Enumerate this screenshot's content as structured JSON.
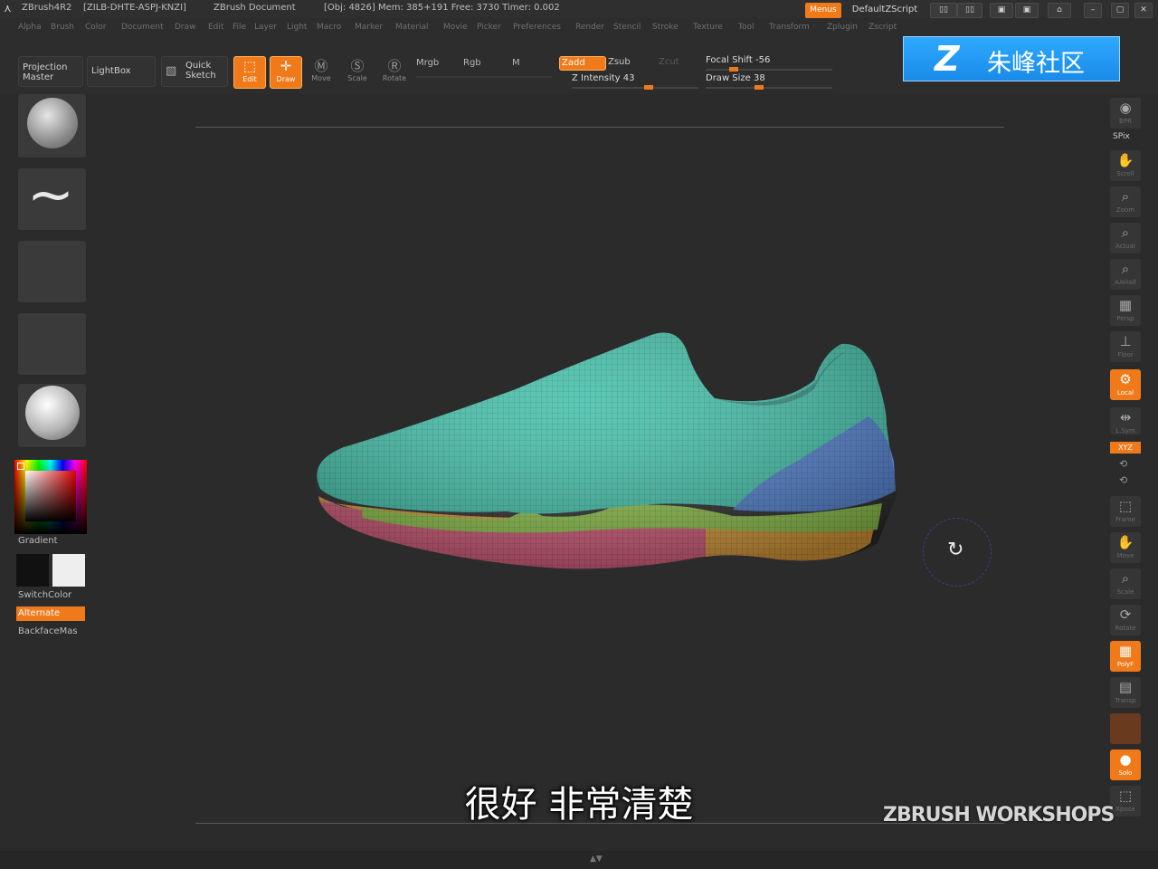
{
  "titlebar": {
    "app": "ZBrush4R2",
    "serial": "[ZILB-DHTE-ASPJ-KNZI]",
    "doc": "ZBrush Document",
    "stats": "[Obj: 4826] Mem: 385+191  Free: 3730  Timer: 0.002",
    "menus_label": "Menus",
    "script_label": "DefaultZScript"
  },
  "menubar": [
    "Alpha",
    "Brush",
    "Color",
    "Document",
    "Draw",
    "Edit",
    "File",
    "Layer",
    "Light",
    "Macro",
    "Marker",
    "Material",
    "Movie",
    "Picker",
    "Preferences",
    "Render",
    "Stencil",
    "Stroke",
    "Texture",
    "Tool",
    "Transform",
    "Zplugin",
    "Zscript"
  ],
  "toolbar": {
    "projection_master": "Projection Master",
    "lightbox": "LightBox",
    "quick_sketch": "Quick Sketch",
    "edit": "Edit",
    "draw": "Draw",
    "move": "Move",
    "scale": "Scale",
    "rotate": "Rotate",
    "mrgb": "Mrgb",
    "rgb": "Rgb",
    "m": "M",
    "zadd": "Zadd",
    "zsub": "Zsub",
    "zcut": "Zcut",
    "z_intensity": "Z Intensity 43",
    "focal_shift": "Focal Shift -56",
    "draw_size": "Draw Size 38"
  },
  "watermark": {
    "logo_text": "朱峰社区",
    "footer": "ZBRUSH WORKSHOPS"
  },
  "leftshelf": {
    "gradient": "Gradient",
    "switchcolor": "SwitchColor",
    "alternate": "Alternate",
    "backfacemask": "BackfaceMas"
  },
  "rightshelf": [
    {
      "name": "bpr",
      "label": "BPR",
      "icon": "◉"
    },
    {
      "name": "scroll",
      "label": "Scroll",
      "icon": "✋"
    },
    {
      "name": "zoom",
      "label": "Zoom",
      "icon": "⌕"
    },
    {
      "name": "actual",
      "label": "Actual",
      "icon": "⌕"
    },
    {
      "name": "aahalf",
      "label": "AAHalf",
      "icon": "⌕"
    },
    {
      "name": "persp",
      "label": "Persp",
      "icon": "▦"
    },
    {
      "name": "floor",
      "label": "Floor",
      "icon": "⊥"
    },
    {
      "name": "local",
      "label": "Local",
      "icon": "⚙"
    },
    {
      "name": "lsym",
      "label": "L.Sym",
      "icon": "⇹"
    },
    {
      "name": "frame",
      "label": "Frame",
      "icon": "⬚"
    },
    {
      "name": "move",
      "label": "Move",
      "icon": "✋"
    },
    {
      "name": "scale",
      "label": "Scale",
      "icon": "⌕"
    },
    {
      "name": "rotate",
      "label": "Rotate",
      "icon": "⟳"
    },
    {
      "name": "polyf",
      "label": "PolyF",
      "icon": "▦"
    },
    {
      "name": "transp",
      "label": "Transp",
      "icon": "▤"
    },
    {
      "name": "solo",
      "label": "Solo",
      "icon": "●"
    },
    {
      "name": "xpose",
      "label": "Xpose",
      "icon": "⬚"
    }
  ],
  "xyz_label": "XYZ",
  "spix_label": "SPix",
  "subtitle": "很好  非常清楚",
  "colors": {
    "accent": "#f07a1a",
    "shoe_upper": "#3fbfa8",
    "shoe_heel": "#4f7fcf",
    "shoe_mid": "#8cc24a",
    "shoe_sole": "#d25b78",
    "shoe_orange": "#d99a3a"
  }
}
